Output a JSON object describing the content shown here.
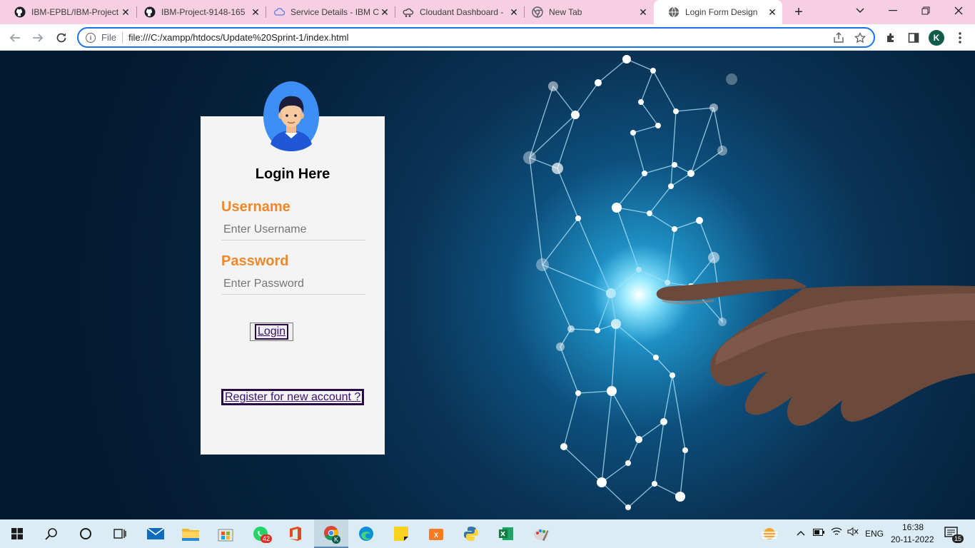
{
  "browser": {
    "tabs": [
      {
        "title": "IBM-EPBL/IBM-Project",
        "icon": "github-icon"
      },
      {
        "title": "IBM-Project-9148-165",
        "icon": "github-icon"
      },
      {
        "title": "Service Details - IBM C",
        "icon": "cloud-icon"
      },
      {
        "title": "Cloudant Dashboard -",
        "icon": "cloudant-icon"
      },
      {
        "title": "New Tab",
        "icon": "chrome-icon"
      },
      {
        "title": "Login Form Design",
        "icon": "globe-icon",
        "active": true
      }
    ],
    "scheme_label": "File",
    "url": "file:///C:/xampp/htdocs/Update%20Sprint-1/index.html",
    "profile_initial": "K"
  },
  "login": {
    "title": "Login Here",
    "username_label": "Username",
    "username_placeholder": "Enter Username",
    "password_label": "Password",
    "password_placeholder": "Enter Password",
    "login_button": "Login",
    "register_link": "Register for new account ?"
  },
  "taskbar": {
    "apps": [
      "start",
      "search",
      "task-view",
      "widgets",
      "mail",
      "file-explorer",
      "microsoft-store",
      "whatsapp",
      "office",
      "chrome",
      "edge",
      "sticky-notes",
      "xampp",
      "python",
      "excel",
      "paint"
    ],
    "whatsapp_badge": "42",
    "chrome_badge": "K",
    "language": "ENG",
    "time": "16:38",
    "date": "20-11-2022",
    "notification_count": "15"
  },
  "colors": {
    "label_accent": "#f0882b",
    "link_color": "#3b0f72",
    "tab_strip": "#f7cfe2",
    "focus_ring": "#1a73e8"
  }
}
